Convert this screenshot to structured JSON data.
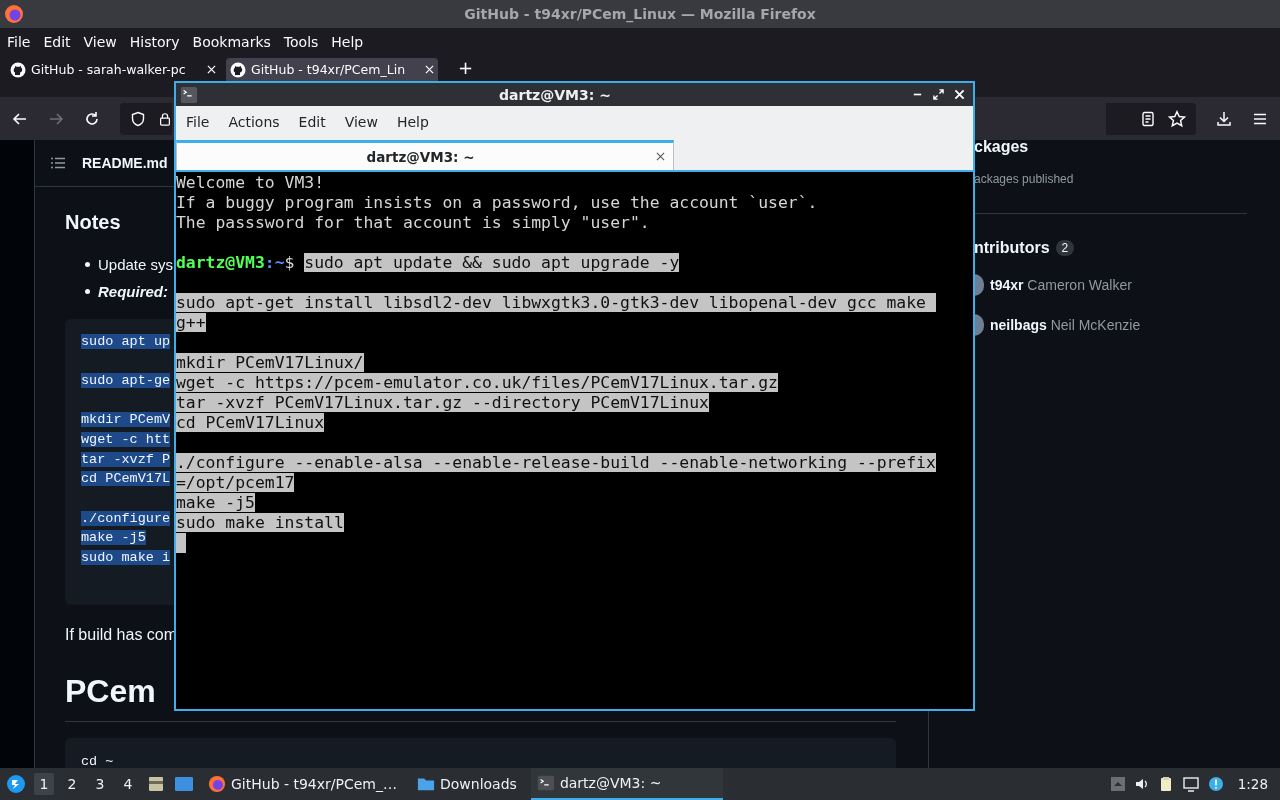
{
  "browser": {
    "title": "GitHub - t94xr/PCem_Linux — Mozilla Firefox",
    "menu": [
      "File",
      "Edit",
      "View",
      "History",
      "Bookmarks",
      "Tools",
      "Help"
    ],
    "tabs": [
      {
        "label": "GitHub - sarah-walker-pc",
        "selected": false
      },
      {
        "label": "GitHub - t94xr/PCem_Lin",
        "selected": true
      }
    ],
    "new_tab": "+"
  },
  "readme": {
    "file": "README.md",
    "heading": "Notes",
    "bullets": [
      {
        "text": "Update sys",
        "bold": false
      },
      {
        "text": "Required:",
        "bold": true
      }
    ],
    "code": {
      "selected": true,
      "groups": [
        [
          "sudo apt up"
        ],
        [
          "sudo apt-ge"
        ],
        [
          "mkdir PCemV",
          "wget -c htt",
          "tar -xvzf P",
          "cd PCemV17L"
        ],
        [
          "./configure",
          "make -j5",
          "sudo make i"
        ]
      ]
    },
    "paragraph": "If build has com",
    "heading2": "PCem",
    "code2": [
      "cd ~"
    ]
  },
  "sidebar": {
    "packages_heading": "ckages",
    "packages_note": "ackages published",
    "contributors_heading": "ntributors",
    "contributors_count": "2",
    "contributors": [
      {
        "login": "t94xr",
        "name": "Cameron Walker"
      },
      {
        "login": "neilbags",
        "name": "Neil McKenzie"
      }
    ]
  },
  "terminal": {
    "title": "dartz@VM3: ~",
    "menu": [
      "File",
      "Actions",
      "Edit",
      "View",
      "Help"
    ],
    "tabs": [
      {
        "label": "dartz@VM3: ~",
        "selected": true
      }
    ],
    "lines": [
      {
        "kind": "text",
        "text": "Welcome to VM3!",
        "selected": false
      },
      {
        "kind": "text",
        "text": "If a buggy program insists on a password, use the account `user`.",
        "selected": false
      },
      {
        "kind": "text",
        "text": "The passsword for that account is simply \"user\".",
        "selected": false
      },
      {
        "kind": "blank"
      },
      {
        "kind": "prompt",
        "user": "dartz@VM3",
        "path": ":~",
        "symbol": "$",
        "command": "sudo apt update && sudo apt upgrade -y",
        "selected": true
      },
      {
        "kind": "blank"
      },
      {
        "kind": "text",
        "text": "sudo apt-get install libsdl2-dev libwxgtk3.0-gtk3-dev libopenal-dev gcc make ",
        "selected": true
      },
      {
        "kind": "text",
        "text": "g++",
        "selected": true
      },
      {
        "kind": "blank"
      },
      {
        "kind": "text",
        "text": "mkdir PCemV17Linux/",
        "selected": true
      },
      {
        "kind": "text",
        "text": "wget -c https://pcem-emulator.co.uk/files/PCemV17Linux.tar.gz",
        "selected": true
      },
      {
        "kind": "text",
        "text": "tar -xvzf PCemV17Linux.tar.gz --directory PCemV17Linux",
        "selected": true
      },
      {
        "kind": "text",
        "text": "cd PCemV17Linux",
        "selected": true
      },
      {
        "kind": "blank"
      },
      {
        "kind": "text",
        "text": "./configure --enable-alsa --enable-release-build --enable-networking --prefix",
        "selected": true
      },
      {
        "kind": "text",
        "text": "=/opt/pcem17",
        "selected": true
      },
      {
        "kind": "text",
        "text": "make -j5",
        "selected": true
      },
      {
        "kind": "text",
        "text": "sudo make install",
        "selected": true
      },
      {
        "kind": "cursor",
        "selected": true
      }
    ]
  },
  "taskbar": {
    "workspaces": [
      {
        "label": "1",
        "selected": true
      },
      {
        "label": "2",
        "selected": false
      },
      {
        "label": "3",
        "selected": false
      },
      {
        "label": "4",
        "selected": false
      }
    ],
    "tasks": [
      {
        "kind": "firefox",
        "label": "GitHub - t94xr/PCem_…",
        "selected": false
      },
      {
        "kind": "folder",
        "label": "Downloads",
        "selected": false
      },
      {
        "kind": "terminal",
        "label": "dartz@VM3: ~",
        "selected": true
      }
    ],
    "clock": "1:28"
  }
}
